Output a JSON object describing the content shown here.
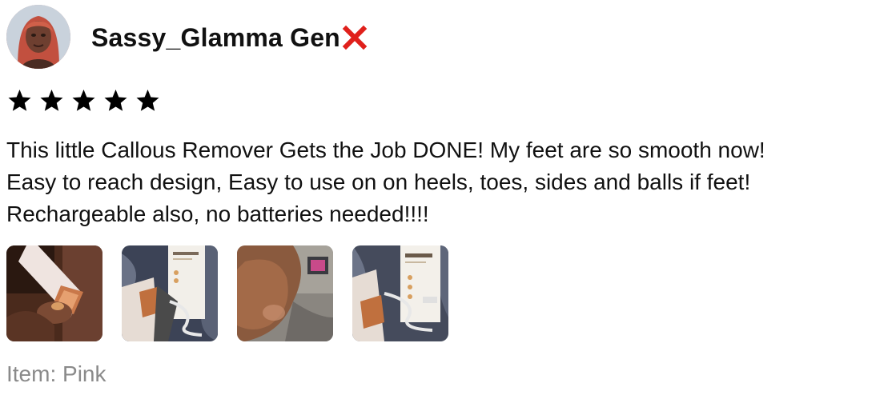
{
  "review": {
    "author": "Sassy_Glamma Gen",
    "author_suffix_icon": "red-x-icon",
    "rating": 5,
    "rating_max": 5,
    "body_lines": [
      "This little Callous Remover Gets the Job DONE! My feet are so smooth now!",
      "Easy to reach design, Easy to use on on heels, toes, sides and balls if feet!",
      "Rechargeable also, no batteries needed!!!!"
    ],
    "photos": [
      {
        "icon": "review-photo-icon"
      },
      {
        "icon": "review-photo-icon"
      },
      {
        "icon": "review-photo-icon"
      },
      {
        "icon": "review-photo-icon"
      }
    ],
    "item_label": "Item: Pink"
  },
  "colors": {
    "text": "#111111",
    "muted": "#8a8a8a",
    "x_mark": "#e0201b",
    "star": "#000000"
  }
}
